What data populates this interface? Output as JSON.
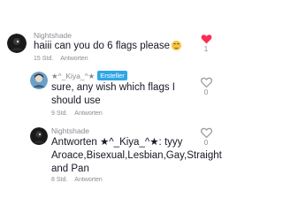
{
  "comments": [
    {
      "username": "Nightshade",
      "text": "haiii can you do 6 flags please",
      "emoji": "pleading-face",
      "time": "15 Std.",
      "reply_label": "Antworten",
      "likes": "1",
      "liked": true,
      "heart_color": "#fe2c55"
    },
    {
      "username": "★^_Kiya_^★",
      "badge": "Ersteller",
      "text": "sure, any wish which flags I should use",
      "time": "9 Std.",
      "reply_label": "Antworten",
      "likes": "0",
      "liked": false
    },
    {
      "username": "Nightshade",
      "text": "Antworten ★^_Kiya_^★: tyyy Aroace,Bisexual,Lesbian,Gay,Straight and Pan",
      "time": "8 Std.",
      "reply_label": "Antworten",
      "likes": "0",
      "liked": false
    }
  ]
}
